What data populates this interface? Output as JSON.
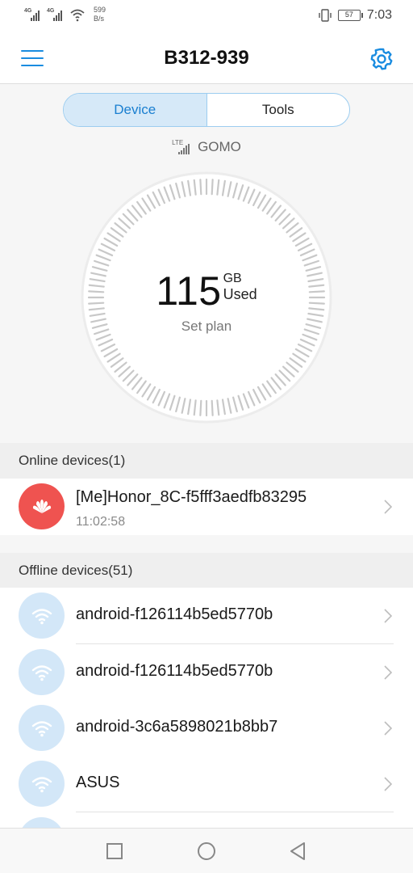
{
  "status_bar": {
    "signal1_tag": "4G",
    "signal2_tag": "4G",
    "net_speed_value": "599",
    "net_speed_unit": "B/s",
    "battery_level": "57",
    "time": "7:03"
  },
  "app_bar": {
    "title": "B312-939",
    "menu_icon": "hamburger-menu-icon",
    "settings_icon": "gear-icon"
  },
  "tabs": [
    {
      "label": "Device",
      "active": true
    },
    {
      "label": "Tools",
      "active": false
    }
  ],
  "network": {
    "type_label": "LTE",
    "carrier": "GOMO"
  },
  "usage": {
    "amount": "115",
    "unit": "GB",
    "used_label": "Used",
    "set_plan_label": "Set plan"
  },
  "online_section": {
    "header": "Online devices(1)",
    "devices": [
      {
        "name": "[Me]Honor_8C-f5fff3aedfb83295",
        "time": "11:02:58",
        "icon": "huawei-logo-icon"
      }
    ]
  },
  "offline_section": {
    "header": "Offline devices(51)",
    "devices": [
      {
        "name": "android-f126114b5ed5770b",
        "icon": "wifi-icon"
      },
      {
        "name": "android-f126114b5ed5770b",
        "icon": "wifi-icon"
      },
      {
        "name": "android-3c6a5898021b8bb7",
        "icon": "wifi-icon"
      },
      {
        "name": "ASUS",
        "icon": "wifi-icon"
      }
    ]
  },
  "colors": {
    "accent": "#1a8ce0",
    "online_avatar": "#ef5350",
    "offline_avatar": "#d3e7f8",
    "tab_active_bg": "#d6e9f8"
  }
}
